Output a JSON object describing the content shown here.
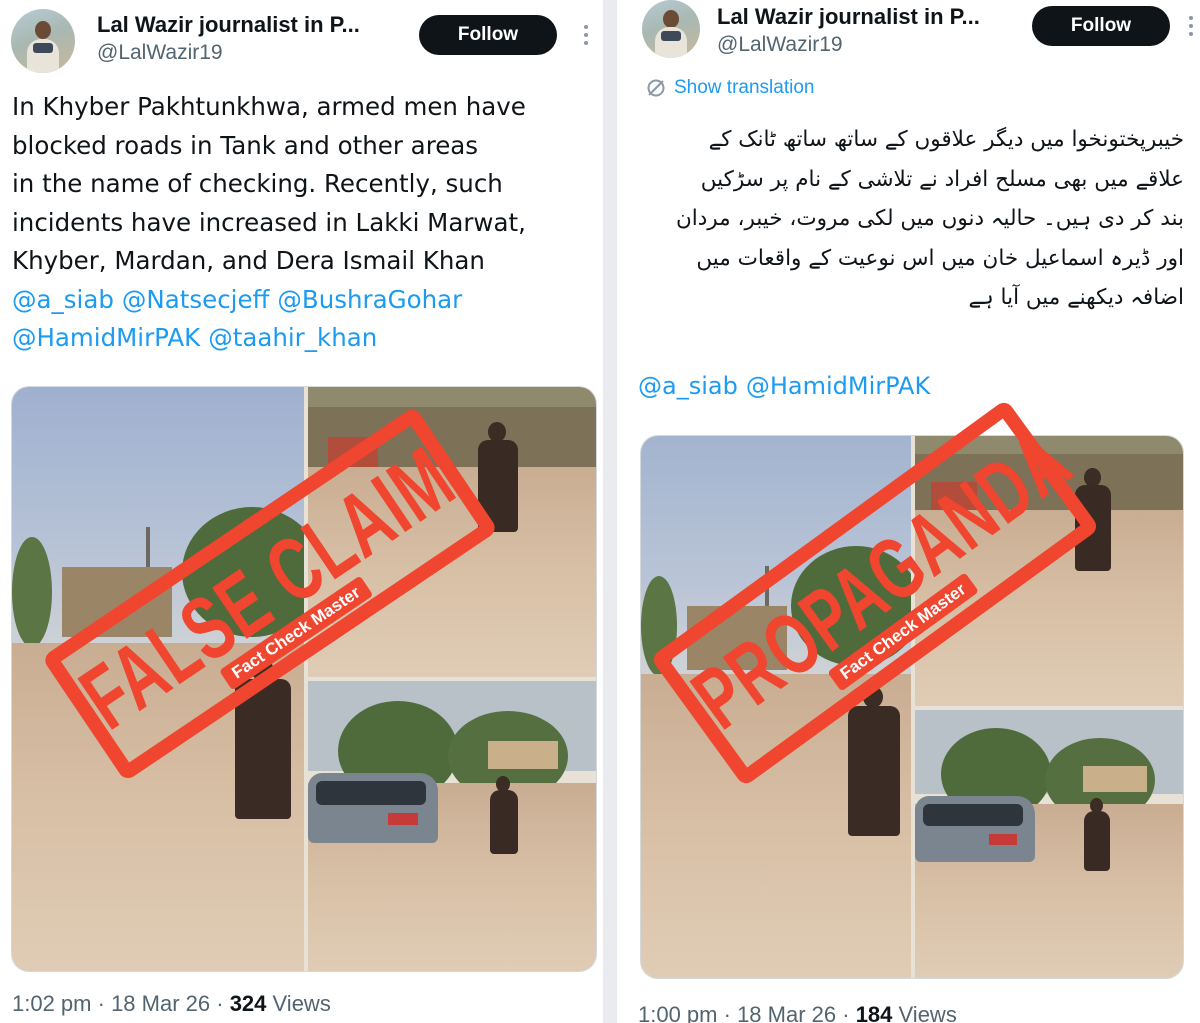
{
  "left_post": {
    "author": {
      "display_name": "Lal Wazir journalist in P...",
      "handle": "@LalWazir19",
      "follow_label": "Follow",
      "more_icon": "more-vertical-icon"
    },
    "text_lines": [
      "In Khyber Pakhtunkhwa, armed men have",
      "blocked roads in Tank and other areas",
      "in the name of checking. Recently, such",
      "incidents have increased in Lakki Marwat,",
      "Khyber, Mardan, and Dera Ismail Khan"
    ],
    "mentions_line1": [
      "@a_siab",
      "@Natsecjeff",
      "@BushraGohar"
    ],
    "mentions_line2": [
      "@HamidMirPAK",
      "@taahir_khan"
    ],
    "stamp": {
      "label": "FALSE CLAIM",
      "sublabel": "Fact Check Master",
      "color": "#f0452e"
    },
    "meta": {
      "time": "1:02 pm",
      "date": "18 Mar 26",
      "views_count": "324",
      "views_label": "Views"
    }
  },
  "right_post": {
    "author": {
      "display_name": "Lal Wazir journalist in P...",
      "handle": "@LalWazir19",
      "follow_label": "Follow",
      "more_icon": "more-vertical-icon"
    },
    "translation_label": "Show translation",
    "translation_icon": "globe-icon",
    "urdu_lines": [
      "خیبرپختونخوا میں دیگر علاقوں کے ساتھ ساتھ ٹانک کے",
      "علاقے میں بھی مسلح افراد نے تلاشی کے نام پر سڑکیں",
      "بند کر دی ہیں۔ حالیہ دنوں میں لکی مروت، خیبر، مردان",
      "اور ڈیرہ اسماعیل خان میں اس نوعیت کے واقعات میں",
      "اضافہ دیکھنے میں آیا ہے"
    ],
    "mentions": [
      "@a_siab",
      "@HamidMirPAK"
    ],
    "stamp": {
      "label": "PROPAGANDA",
      "sublabel": "Fact Check Master",
      "color": "#f0452e"
    },
    "meta": {
      "time": "1:00 pm",
      "date": "18 Mar 26",
      "views_count": "184",
      "views_label": "Views"
    }
  },
  "colors": {
    "accent_link": "#1d9bf0",
    "text_primary": "#0f1419",
    "text_secondary": "#536471",
    "follow_bg": "#0f1419",
    "stamp_red": "#f0452e"
  }
}
